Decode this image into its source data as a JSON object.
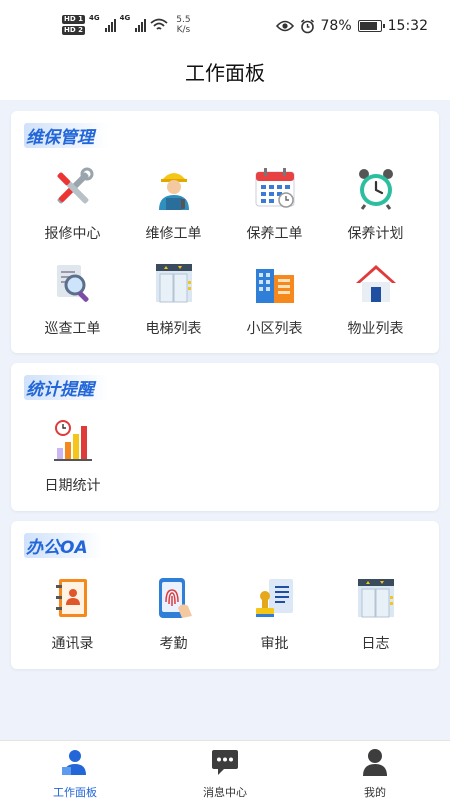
{
  "status_bar": {
    "network_1": "4G",
    "network_2": "4G",
    "speed_value": "5.5",
    "speed_unit": "K/s",
    "battery_percent": "78%",
    "battery_level": 0.78,
    "time": "15:32",
    "hd_1": "HD 1",
    "hd_2": "HD 2"
  },
  "header": {
    "title": "工作面板"
  },
  "sections": {
    "maintenance": {
      "title": "维保管理",
      "items": [
        {
          "label": "报修中心",
          "icon": "tools-icon"
        },
        {
          "label": "维修工单",
          "icon": "repair-worker-icon"
        },
        {
          "label": "保养工单",
          "icon": "calendar-icon"
        },
        {
          "label": "保养计划",
          "icon": "alarm-clock-icon"
        },
        {
          "label": "巡查工单",
          "icon": "document-search-icon"
        },
        {
          "label": "电梯列表",
          "icon": "elevator-icon"
        },
        {
          "label": "小区列表",
          "icon": "buildings-icon"
        },
        {
          "label": "物业列表",
          "icon": "house-icon"
        }
      ]
    },
    "statistics": {
      "title": "统计提醒",
      "items": [
        {
          "label": "日期统计",
          "icon": "bar-chart-clock-icon"
        }
      ]
    },
    "office": {
      "title": "办公OA",
      "items": [
        {
          "label": "通讯录",
          "icon": "contacts-book-icon"
        },
        {
          "label": "考勤",
          "icon": "fingerprint-icon"
        },
        {
          "label": "审批",
          "icon": "stamp-icon"
        },
        {
          "label": "日志",
          "icon": "log-icon"
        }
      ]
    }
  },
  "bottom_nav": [
    {
      "label": "工作面板",
      "icon": "dashboard-user-icon",
      "active": true
    },
    {
      "label": "消息中心",
      "icon": "message-icon",
      "active": false
    },
    {
      "label": "我的",
      "icon": "profile-icon",
      "active": false
    }
  ],
  "colors": {
    "accent": "#2266d8",
    "background": "#eef2fb"
  }
}
